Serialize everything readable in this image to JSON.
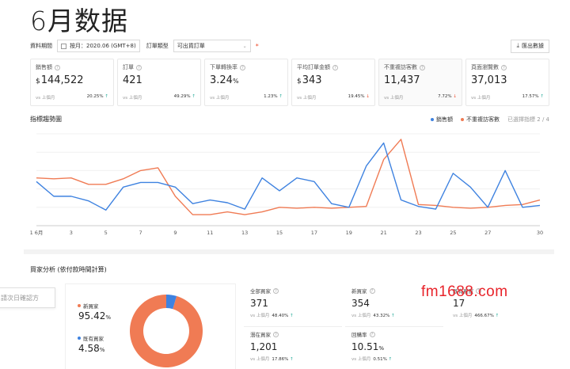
{
  "page_title": "6月数据",
  "filters": {
    "period_label": "資料期間",
    "period_value": "按月：2020.06 (GMT+8)",
    "order_type_label": "訂單類型",
    "order_type_value": "可出貨訂單",
    "required_mark": "*",
    "export_label": "匯出數據"
  },
  "kpis": [
    {
      "label": "銷售額",
      "prefix": "$",
      "value": "144,522",
      "suffix": "",
      "compare_label": "vs 上個月",
      "pct": "20.25%",
      "dir": "up"
    },
    {
      "label": "訂單",
      "prefix": "",
      "value": "421",
      "suffix": "",
      "compare_label": "vs 上個月",
      "pct": "49.29%",
      "dir": "up"
    },
    {
      "label": "下單轉換率",
      "prefix": "",
      "value": "3.24",
      "suffix": "%",
      "compare_label": "vs 上個月",
      "pct": "1.23%",
      "dir": "up"
    },
    {
      "label": "平均訂單金額",
      "prefix": "$",
      "value": "343",
      "suffix": "",
      "compare_label": "vs 上個月",
      "pct": "19.45%",
      "dir": "down"
    },
    {
      "label": "不重複訪客數",
      "prefix": "",
      "value": "11,437",
      "suffix": "",
      "compare_label": "vs 上個月",
      "pct": "7.72%",
      "dir": "down"
    },
    {
      "label": "頁面瀏覽數",
      "prefix": "",
      "value": "37,013",
      "suffix": "",
      "compare_label": "vs 上個月",
      "pct": "17.57%",
      "dir": "up"
    }
  ],
  "trend": {
    "title": "指標趨勢圖",
    "legend": [
      "銷售額",
      "不重複訪客數"
    ],
    "selected_note": "已選擇指標 2 / 4"
  },
  "chart_data": {
    "type": "line",
    "title": "指標趨勢圖",
    "x_tick_labels": [
      "1 6月",
      "3",
      "5",
      "7",
      "9",
      "11",
      "13",
      "15",
      "17",
      "19",
      "21",
      "23",
      "25",
      "27",
      "30"
    ],
    "x": [
      1,
      2,
      3,
      4,
      5,
      6,
      7,
      8,
      9,
      10,
      11,
      12,
      13,
      14,
      15,
      16,
      17,
      18,
      19,
      20,
      21,
      22,
      23,
      24,
      25,
      26,
      27,
      28,
      29,
      30
    ],
    "ylim": [
      0,
      100
    ],
    "grid": true,
    "legend_position": "top-right",
    "series": [
      {
        "name": "銷售額",
        "color": "#3e82e0",
        "values": [
          48,
          32,
          32,
          27,
          17,
          42,
          47,
          47,
          42,
          24,
          28,
          25,
          18,
          52,
          38,
          52,
          48,
          24,
          20,
          65,
          90,
          28,
          21,
          18,
          57,
          42,
          20,
          60,
          20,
          22
        ]
      },
      {
        "name": "不重複訪客數",
        "color": "#f07b54",
        "values": [
          52,
          51,
          52,
          45,
          45,
          51,
          60,
          63,
          32,
          12,
          12,
          15,
          12,
          15,
          20,
          19,
          20,
          19,
          20,
          21,
          72,
          94,
          23,
          22,
          20,
          19,
          20,
          22,
          23,
          28
        ]
      }
    ]
  },
  "buyer": {
    "title": "買家分析 (依付款時間計算)",
    "tooltip_text": "請次日確認方",
    "donut_legend": [
      {
        "label": "新買家",
        "value": "95.42",
        "unit": "%",
        "color": "#f07b54"
      },
      {
        "label": "既有買家",
        "value": "4.58",
        "unit": "%",
        "color": "#3e82e0"
      }
    ],
    "donut_values": [
      95.42,
      4.58
    ],
    "stats": [
      {
        "label": "全部買家",
        "value": "371",
        "suffix": "",
        "compare_label": "vs 上個月",
        "pct": "48.40%",
        "dir": "up"
      },
      {
        "label": "新買家",
        "value": "354",
        "suffix": "",
        "compare_label": "vs 上個月",
        "pct": "43.32%",
        "dir": "up"
      },
      {
        "label": "既有買家",
        "value": "17",
        "suffix": "",
        "compare_label": "vs 上個月",
        "pct": "466.67%",
        "dir": "up"
      },
      {
        "label": "潛在買家",
        "value": "1,201",
        "suffix": "",
        "compare_label": "vs 上個月",
        "pct": "17.86%",
        "dir": "up"
      },
      {
        "label": "回購率",
        "value": "10.51",
        "suffix": "%",
        "compare_label": "vs 上個月",
        "pct": "0.51%",
        "dir": "up"
      }
    ]
  },
  "watermark": "fm1688.com",
  "colors": {
    "orange": "#f07b54",
    "blue": "#3e82e0",
    "up": "#26aa99",
    "down": "#ee4d2d"
  }
}
